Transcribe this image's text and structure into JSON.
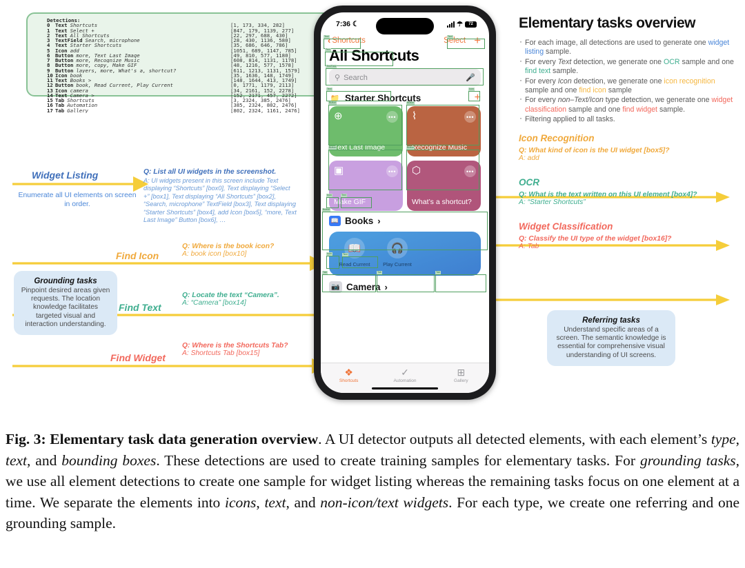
{
  "detections": {
    "header": "Detections:",
    "rows": [
      {
        "idx": "0",
        "type": "Text",
        "text": "Shortcuts",
        "box": "[1, 173, 334, 282]"
      },
      {
        "idx": "1",
        "type": "Text",
        "text": "Select +",
        "box": "[847, 179, 1139, 277]"
      },
      {
        "idx": "2",
        "type": "Text",
        "text": "All Shortcuts",
        "box": "[22, 297, 688, 430]"
      },
      {
        "idx": "3",
        "type": "TextField",
        "text": "Search, microphone",
        "box": "[28, 430, 1136, 580]"
      },
      {
        "idx": "4",
        "type": "Text",
        "text": "Starter Shortcuts",
        "box": "[35, 686, 646, 786]"
      },
      {
        "idx": "5",
        "type": "Icon",
        "text": "add",
        "box": "[1051, 689, 1147, 785]"
      },
      {
        "idx": "6",
        "type": "Button",
        "text": "more, Text Last Image",
        "box": "[49, 810, 577, 1180]"
      },
      {
        "idx": "7",
        "type": "Button",
        "text": "more, Recognize Music",
        "box": "[608, 814, 1131, 1178]"
      },
      {
        "idx": "8",
        "type": "Button",
        "text": "more, copy, Make GIF",
        "box": "[48, 1216, 577, 1578]"
      },
      {
        "idx": "9",
        "type": "Button",
        "text": "layers, more, What's a, shortcut?",
        "box": "[611, 1213, 1131, 1579]"
      },
      {
        "idx": "10",
        "type": "Icon",
        "text": "book",
        "box": "[35, 1636, 148, 1749]"
      },
      {
        "idx": "11",
        "type": "Text",
        "text": "Books >",
        "box": "[148, 1644, 413, 1749]"
      },
      {
        "idx": "12",
        "type": "Button",
        "text": "book, Read Current, Play Current",
        "box": "[0, 1771, 1179, 2113]"
      },
      {
        "idx": "13",
        "type": "Icon",
        "text": "camera",
        "box": "[34, 2161, 152, 2278]"
      },
      {
        "idx": "14",
        "type": "Text",
        "text": "Camera >",
        "box": "[152, 2171, 457, 2272]"
      },
      {
        "idx": "15",
        "type": "Tab",
        "text": "Shortcuts",
        "box": "[3, 2324, 385, 2476]"
      },
      {
        "idx": "16",
        "type": "Tab",
        "text": "Automation",
        "box": "[385, 2324, 802, 2476]"
      },
      {
        "idx": "17",
        "type": "Tab",
        "text": "Gallery",
        "box": "[802, 2324, 1161, 2476]"
      }
    ]
  },
  "phone": {
    "status": {
      "time": "7:36",
      "moon_icon": "☾",
      "battery": "72"
    },
    "nav": {
      "back_label": "Shortcuts",
      "select_label": "Select",
      "add_label": "+"
    },
    "title": "All Shortcuts",
    "search": {
      "placeholder": "Search",
      "search_icon": "search-icon",
      "mic_icon": "microphone-icon"
    },
    "section": {
      "label": "Starter Shortcuts",
      "folder_icon": "folder-icon",
      "add_icon": "+"
    },
    "cards": [
      {
        "name": "Text Last Image",
        "glyph": "⊕",
        "color": "#6cbb6a",
        "more": "•••"
      },
      {
        "name": "Recognize Music",
        "glyph": "⌇",
        "color": "#b9613f",
        "more": "•••"
      },
      {
        "name": "Make GIF",
        "glyph": "▣",
        "color": "#c89fe0",
        "more": "•••"
      },
      {
        "name": "What’s a shortcut?",
        "glyph": "⬡",
        "color": "#b0547a",
        "more": "•••"
      }
    ],
    "books": {
      "label": "Books",
      "chevron": "›",
      "icon": "book-icon",
      "actions": [
        {
          "label": "Read Current",
          "glyph": "📖"
        },
        {
          "label": "Play Current",
          "glyph": "⌂"
        }
      ]
    },
    "camera": {
      "label": "Camera",
      "chevron": "›",
      "icon": "camera-icon"
    },
    "tabs": [
      {
        "label": "Shortcuts",
        "glyph": "❖",
        "active": true
      },
      {
        "label": "Automation",
        "glyph": "✓",
        "active": false
      },
      {
        "label": "Gallery",
        "glyph": "⊞",
        "active": false
      }
    ],
    "overlay_labels": [
      "Text",
      "Text",
      "Text",
      "TextField",
      "Text",
      "Icon",
      "Button",
      "Button",
      "Button",
      "Button",
      "Icon",
      "Text",
      "Button",
      "Icon",
      "Text",
      "Tab",
      "Tab",
      "Tab"
    ]
  },
  "left": {
    "widget_listing": {
      "title": "Widget Listing",
      "desc": "Enumerate all UI elements on screen in order.",
      "q": "Q: List all UI widgets in the screenshot.",
      "a": "A: UI widgets present in this screen include Text displaying “Shortcuts” [box0], Text displaying “Select +” [box1], Text displaying “All Shortcuts” [box2], “Search, microphone” TextField [box3], Text displaying “Starter Shortcuts” [box4], add Icon [box5], “more, Text Last Image” Button [box6], …"
    },
    "grounding": {
      "title": "Grounding tasks",
      "body": "Pinpoint desired areas given requests. The location knowledge facilitates targeted visual and interaction understanding."
    },
    "find_icon": {
      "title": "Find Icon",
      "q": "Q: Where is the book icon?",
      "a": "A: book icon [box10]"
    },
    "find_text": {
      "title": "Find Text",
      "q": "Q: Locate the text “Camera”.",
      "a": "A: “Camera” [box14]"
    },
    "find_widget": {
      "title": "Find Widget",
      "q": "Q: Where is the Shortcuts Tab?",
      "a": "A: Shortcuts Tab [box15]"
    }
  },
  "right": {
    "title": "Elementary tasks overview",
    "bullets": [
      {
        "parts": [
          {
            "t": "For each image, all detections are used to generate one ",
            "c": "grey"
          },
          {
            "t": "widget listing",
            "c": "blue"
          },
          {
            "t": " sample.",
            "c": "grey"
          }
        ]
      },
      {
        "parts": [
          {
            "t": "For every ",
            "c": "grey"
          },
          {
            "t": "Text",
            "c": "italic"
          },
          {
            "t": " detection, we generate one ",
            "c": "grey"
          },
          {
            "t": "OCR",
            "c": "green"
          },
          {
            "t": " sample and one ",
            "c": "grey"
          },
          {
            "t": "find text",
            "c": "green"
          },
          {
            "t": " sample.",
            "c": "grey"
          }
        ]
      },
      {
        "parts": [
          {
            "t": "For every ",
            "c": "grey"
          },
          {
            "t": "Icon",
            "c": "italic"
          },
          {
            "t": " detection, we generate one ",
            "c": "grey"
          },
          {
            "t": "icon recognition",
            "c": "orange"
          },
          {
            "t": " sample and one ",
            "c": "grey"
          },
          {
            "t": "find icon",
            "c": "orange"
          },
          {
            "t": " sample",
            "c": "grey"
          }
        ]
      },
      {
        "parts": [
          {
            "t": "For every ",
            "c": "grey"
          },
          {
            "t": "non–Text/Icon",
            "c": "italic"
          },
          {
            "t": " type detection, we generate one ",
            "c": "grey"
          },
          {
            "t": "widget classification",
            "c": "red"
          },
          {
            "t": " sample and one ",
            "c": "grey"
          },
          {
            "t": "find widget",
            "c": "red"
          },
          {
            "t": " sample.",
            "c": "grey"
          }
        ]
      },
      {
        "parts": [
          {
            "t": "Filtering applied to all tasks.",
            "c": "grey"
          }
        ]
      }
    ],
    "icon_recognition": {
      "title": "Icon Recognition",
      "q": "Q: What kind of icon is the UI widget [box5]?",
      "a": "A: add"
    },
    "ocr": {
      "title": "OCR",
      "q": "Q: What is the text written on this UI element [box4]?",
      "a": "A: “Starter Shortcuts”"
    },
    "widget_classification": {
      "title": "Widget Classification",
      "q": "Q: Classify the UI type of the widget [box16]?",
      "a": "A: Tab"
    },
    "referring": {
      "title": "Referring tasks",
      "body": "Understand specific areas of a screen. The semantic knowledge is essential for comprehensive visual understanding of UI screens."
    }
  },
  "caption": {
    "label": "Fig. 3:",
    "bold": "Elementary task data generation overview",
    "rest_1": ". A UI detector outputs all detected elements, with each element’s ",
    "i1": "type",
    "sep1": ", ",
    "i2": "text",
    "sep2": ", and ",
    "i3": "bounding boxes",
    "rest_2": ". These detections are used to create training samples for elementary tasks. For ",
    "i4": "grounding tasks",
    "rest_3": ", we use all element detections to create one sample for widget listing whereas the remaining tasks focus on one element at a time. We separate the elements into ",
    "i5": "icons",
    "sep3": ", ",
    "i6": "text",
    "sep4": ", and ",
    "i7": "non-icon/text widgets",
    "rest_4": ". For each type, we create one referring and one grounding sample."
  },
  "colors": {
    "accent_orange": "#ef7337",
    "detection_green": "#4f9e5e",
    "arrow_yellow": "#f5cd3a",
    "blue": "#4a86d8",
    "green": "#3fae8f",
    "orange": "#f0a93c",
    "red": "#f2685c"
  }
}
